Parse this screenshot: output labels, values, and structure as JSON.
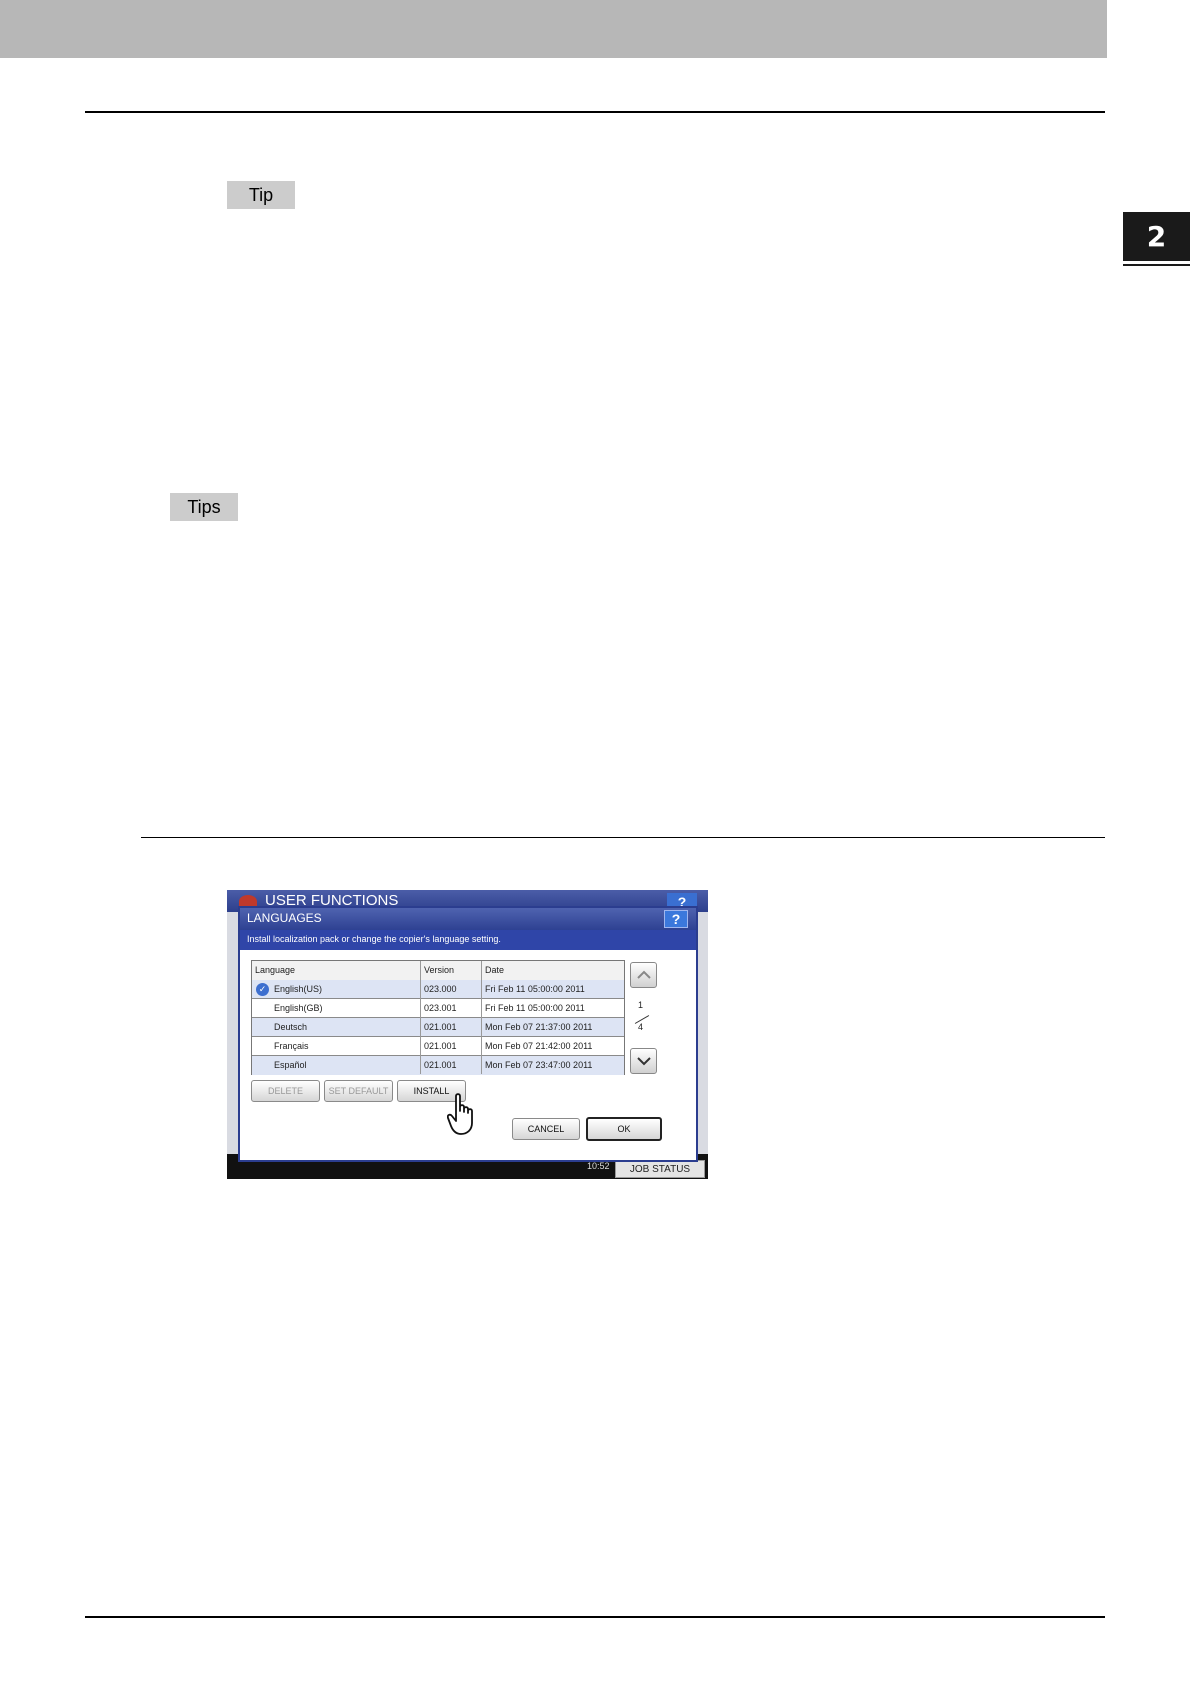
{
  "page": {
    "chapter_number": "2",
    "tip_label_1": "Tip",
    "tip_label_2": "Tips"
  },
  "screenshot": {
    "background_title": "USER FUNCTIONS",
    "background_help": "?",
    "footer_clock": "10:52",
    "footer_job_status": "JOB STATUS",
    "dialog": {
      "title": "LANGUAGES",
      "help": "?",
      "message": "Install localization pack or change the copier's language setting.",
      "columns": [
        "Language",
        "Version",
        "Date"
      ],
      "rows": [
        {
          "language": "English(US)",
          "version": "023.000",
          "date": "Fri Feb 11 05:00:00 2011",
          "selected": true
        },
        {
          "language": "English(GB)",
          "version": "023.001",
          "date": "Fri Feb 11 05:00:00 2011",
          "selected": false
        },
        {
          "language": "Deutsch",
          "version": "021.001",
          "date": "Mon Feb 07 21:37:00 2011",
          "selected": false
        },
        {
          "language": "Français",
          "version": "021.001",
          "date": "Mon Feb 07 21:42:00 2011",
          "selected": false
        },
        {
          "language": "Español",
          "version": "021.001",
          "date": "Mon Feb 07 23:47:00 2011",
          "selected": false
        }
      ],
      "page_current": "1",
      "page_total": "4",
      "buttons": {
        "delete": "DELETE",
        "set_default": "SET DEFAULT",
        "install": "INSTALL",
        "cancel": "CANCEL",
        "ok": "OK"
      }
    }
  },
  "colors": {
    "title_bar": "#2e4192",
    "message_bar": "#2f45a8",
    "row_highlight": "#dde4f4",
    "check_icon": "#3d6fcf"
  }
}
